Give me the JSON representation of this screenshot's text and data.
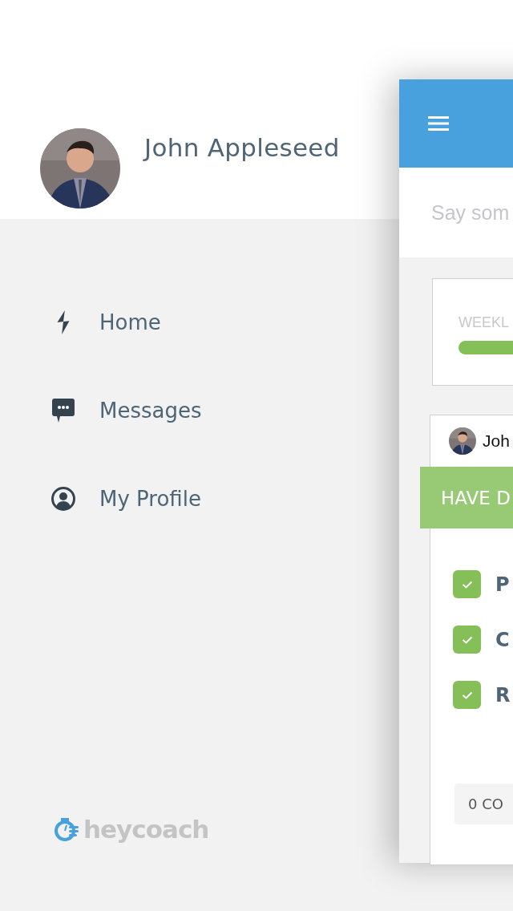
{
  "drawer": {
    "user": {
      "name": "John Appleseed"
    },
    "menu": [
      {
        "label": "Home"
      },
      {
        "label": "Messages"
      },
      {
        "label": "My Profile"
      }
    ],
    "logo": {
      "text": "heycoach"
    }
  },
  "main": {
    "composer": {
      "placeholder": "Say som"
    },
    "weekly": {
      "label": "WEEKL"
    },
    "post": {
      "author": "Joh",
      "banner": "HAVE D",
      "tasks": [
        {
          "label": "P",
          "checked": true
        },
        {
          "label": "C",
          "checked": true
        },
        {
          "label": "R",
          "checked": true
        }
      ],
      "comments": "0 CO"
    }
  }
}
